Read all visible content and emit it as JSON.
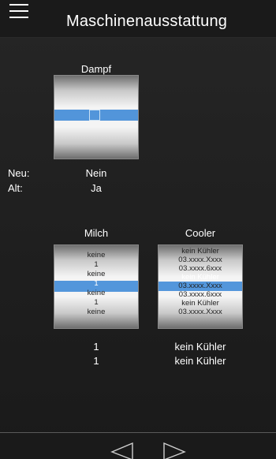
{
  "header": {
    "title": "Maschinenausstattung",
    "menu_icon": "hamburger-menu-icon"
  },
  "dampf": {
    "label": "Dampf"
  },
  "state": {
    "neu_label": "Neu:",
    "alt_label": "Alt:",
    "dampf_neu": "Nein",
    "dampf_alt": "Ja"
  },
  "milch": {
    "label": "Milch",
    "items": [
      "keine",
      "1",
      "keine",
      "1",
      "keine",
      "1",
      "keine"
    ],
    "selected_index": 3,
    "neu": "1",
    "alt": "1"
  },
  "cooler": {
    "label": "Cooler",
    "items": [
      "kein Kühler",
      "03.xxxx.Xxxx",
      "03.xxxx.6xxx",
      "kein Kühler",
      "03.xxxx.Xxxx",
      "03.xxxx.6xxx",
      "kein Kühler",
      "03.xxxx.Xxxx"
    ],
    "selected_index": 3,
    "neu": "kein Kühler",
    "alt": "kein Kühler"
  },
  "footer": {
    "back_icon": "triangle-left-icon",
    "forward_icon": "triangle-right-icon"
  },
  "colors": {
    "accent": "#4a90d9",
    "background": "#1c1c1c",
    "text": "#ffffff"
  }
}
